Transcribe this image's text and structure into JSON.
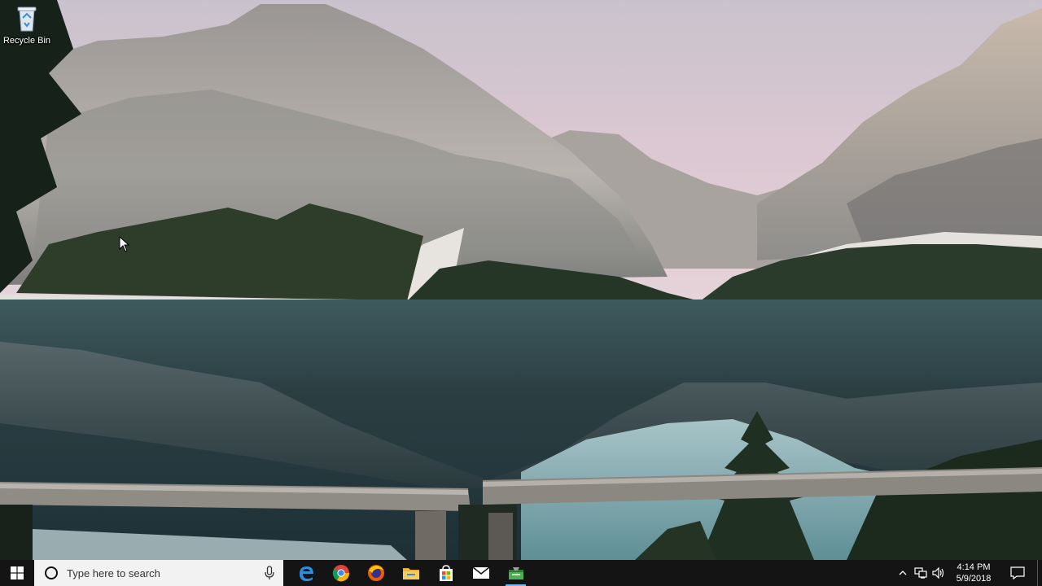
{
  "desktop": {
    "wallpaper": "mountain-lake-wallpaper",
    "icons": [
      {
        "label": "Recycle Bin",
        "icon": "recycle-bin-icon"
      }
    ]
  },
  "taskbar": {
    "start_icon": "windows-logo-icon",
    "search": {
      "placeholder": "Type here to search",
      "mic_icon": "microphone-icon"
    },
    "apps": [
      {
        "name": "Microsoft Edge",
        "icon": "edge-icon",
        "active": false
      },
      {
        "name": "Google Chrome",
        "icon": "chrome-icon",
        "active": false
      },
      {
        "name": "Firefox",
        "icon": "firefox-icon",
        "active": false
      },
      {
        "name": "File Explorer",
        "icon": "file-explorer-icon",
        "active": false
      },
      {
        "name": "Microsoft Store",
        "icon": "store-icon",
        "active": false
      },
      {
        "name": "Mail",
        "icon": "mail-icon",
        "active": false
      },
      {
        "name": "Application",
        "icon": "app-icon",
        "active": true
      }
    ],
    "tray": {
      "icons": [
        "chevron-up-icon",
        "network-icon",
        "volume-icon"
      ],
      "time": "4:14 PM",
      "date": "5/9/2018",
      "notification_icon": "action-center-icon"
    }
  },
  "colors": {
    "taskbar": "#141414",
    "search_bg": "#f2f2f2",
    "active_indicator": "#76b9ed"
  }
}
